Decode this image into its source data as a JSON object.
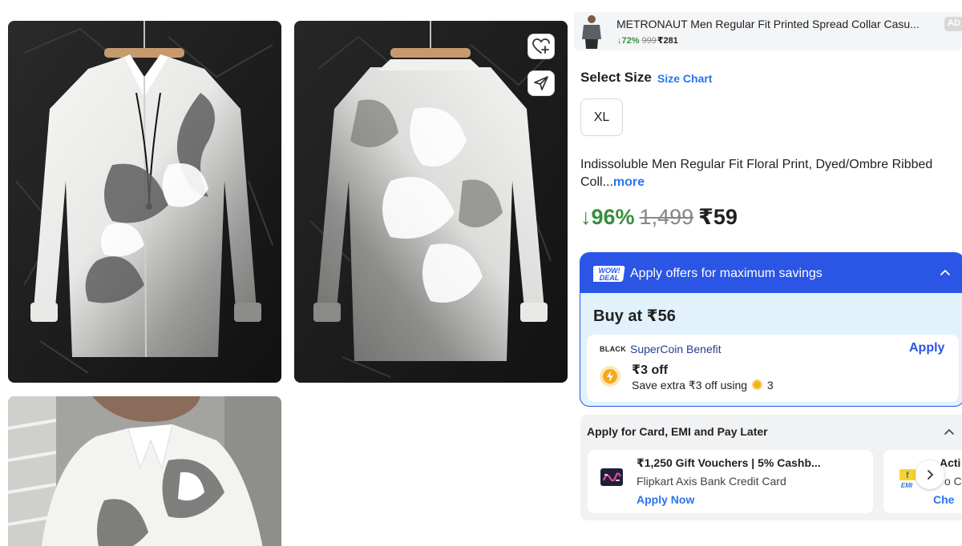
{
  "sponsored": {
    "title": "METRONAUT Men Regular Fit Printed Spread Collar Casu...",
    "discount": "↓72%",
    "mrp": "999",
    "price": "₹281",
    "badge": "AD"
  },
  "size": {
    "heading": "Select Size",
    "chart_link": "Size Chart",
    "options": [
      "XL"
    ]
  },
  "product": {
    "title": "Indissoluble Men Regular Fit Floral Print, Dyed/Ombre Ribbed Coll...",
    "more_link": "more",
    "discount": "↓96%",
    "mrp": "1,499",
    "price": "₹59"
  },
  "offers": {
    "header": "Apply offers for maximum savings",
    "badge_line1": "WOW!",
    "badge_line2": "DEAL",
    "buy_at": "Buy at ₹56",
    "supercoin": {
      "tag": "BLACK",
      "title": "SuperCoin Benefit",
      "apply_label": "Apply",
      "amount": "₹3 off",
      "save_prefix": "Save extra ₹3 off using",
      "coins": "3"
    }
  },
  "payment": {
    "title": "Apply for Card, EMI and Pay Later",
    "bank_offer": {
      "title": "₹1,250 Gift Vouchers | 5% Cashb...",
      "subtitle": "Flipkart Axis Bank Credit Card",
      "cta": "Apply Now"
    },
    "emi_offer": {
      "title": "Acti",
      "subtitle": "o C",
      "cta": "Che",
      "logo_text": "EMI"
    }
  },
  "colors": {
    "brand_blue": "#2874f0",
    "deal_blue": "#2a55e5",
    "discount_green": "#388e3c",
    "offer_bg": "#e2f2fd"
  },
  "icons": [
    "wishlist-heart-plus-icon",
    "share-send-icon",
    "chevron-up-icon",
    "chevron-right-icon",
    "supercoin-icon"
  ]
}
